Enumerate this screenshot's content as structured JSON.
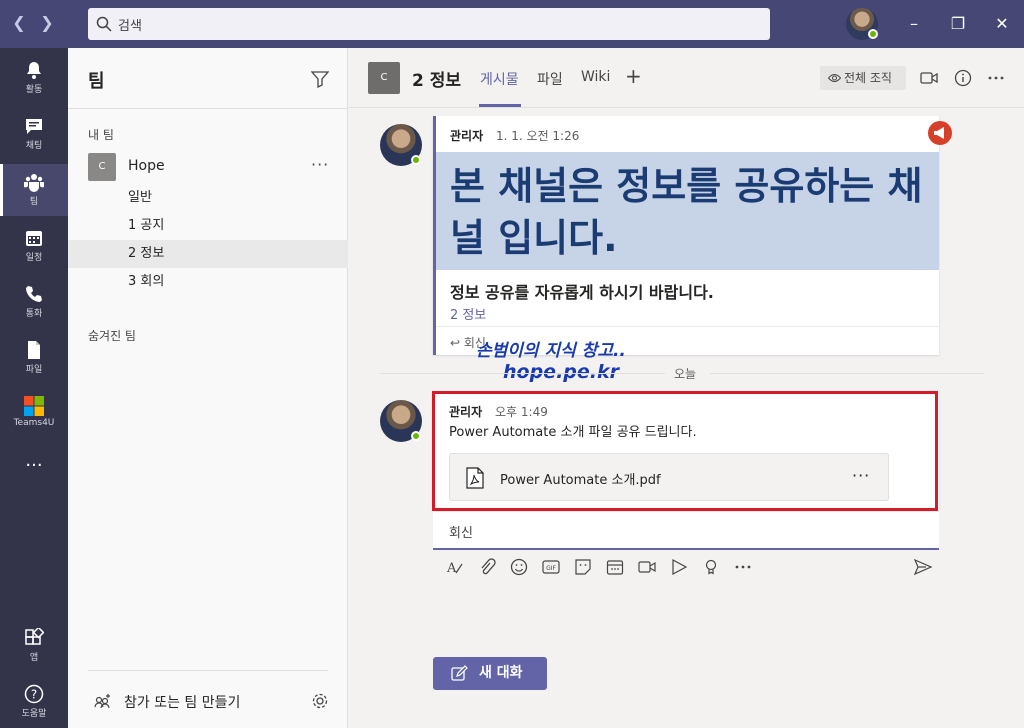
{
  "titlebar": {
    "search_placeholder": "검색",
    "back_icon": "chevron-left-icon",
    "forward_icon": "chevron-right-icon"
  },
  "rail": {
    "items": [
      {
        "label": "활동",
        "icon": "bell-icon"
      },
      {
        "label": "채팅",
        "icon": "chat-icon"
      },
      {
        "label": "팀",
        "icon": "teams-icon"
      },
      {
        "label": "일정",
        "icon": "calendar-icon"
      },
      {
        "label": "통화",
        "icon": "phone-icon"
      },
      {
        "label": "파일",
        "icon": "file-icon"
      },
      {
        "label": "Teams4U",
        "icon": "app-tile-icon"
      }
    ],
    "more": "···",
    "apps_label": "앱",
    "help_label": "도움말"
  },
  "teams_pane": {
    "title": "팀",
    "my_teams_label": "내 팀",
    "team": {
      "avatar_letter": "C",
      "name": "Hope",
      "more": "···"
    },
    "channels": [
      "일반",
      "1 공지",
      "2 정보",
      "3 회의"
    ],
    "active_channel": "2 정보",
    "hidden_teams_label": "숨겨진 팀",
    "join_label": "참가 또는 팀 만들기"
  },
  "header": {
    "channel_avatar": "C",
    "channel_title": "2 정보",
    "tabs": [
      "게시물",
      "파일",
      "Wiki"
    ],
    "add_tab": "+",
    "org_label": "전체 조직"
  },
  "posts": {
    "announcement": {
      "author": "관리자",
      "time": "1. 1. 오전 1:26",
      "headline": "본 채널은 정보를 공유하는 채널 입니다.",
      "subheadline": "정보 공유를 자유롭게 하시기 바랍니다.",
      "channel_link": "2 정보",
      "reply_label": "회신"
    },
    "day_divider": "오늘",
    "message": {
      "author": "관리자",
      "time": "오후 1:49",
      "text": "Power Automate 소개 파일 공유 드립니다.",
      "file_name": "Power Automate 소개.pdf",
      "file_more": "···"
    },
    "reply_placeholder": "회신"
  },
  "watermark": {
    "line1": "손범이의 지식 창고..",
    "line2": "hope.pe.kr"
  },
  "new_conversation_label": "새 대화",
  "colors": {
    "accent": "#6264a7",
    "titlebar": "#464775",
    "rail": "#33344a",
    "highlight": "#d31c28",
    "announce_bg": "#c7d4e8",
    "announce_text": "#1b3b73"
  }
}
